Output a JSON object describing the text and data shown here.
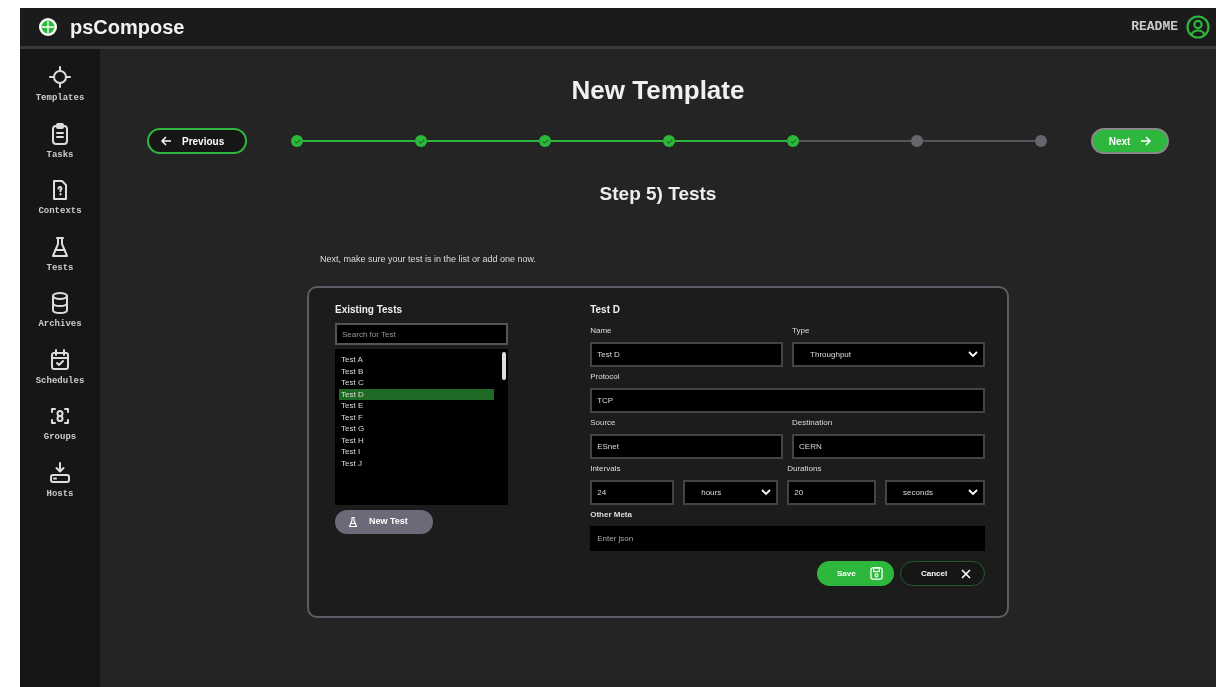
{
  "app": {
    "title": "psCompose",
    "readme": "README"
  },
  "sidebar": {
    "items": [
      {
        "label": "Templates",
        "selected": false
      },
      {
        "label": "Tasks",
        "selected": false
      },
      {
        "label": "Contexts",
        "selected": false
      },
      {
        "label": "Tests",
        "selected": false
      },
      {
        "label": "Archives",
        "selected": false
      },
      {
        "label": "Schedules",
        "selected": false
      },
      {
        "label": "Groups",
        "selected": false
      },
      {
        "label": "Hosts",
        "selected": false
      }
    ]
  },
  "page": {
    "title": "New Template",
    "previous": "Previous",
    "next": "Next",
    "step_title": "Step 5) Tests",
    "instruction": "Next, make sure your test is in the list or add one now."
  },
  "steps": [
    {
      "done": true
    },
    {
      "done": true
    },
    {
      "done": true
    },
    {
      "done": true
    },
    {
      "done": true
    },
    {
      "done": false
    },
    {
      "done": false
    }
  ],
  "tests": {
    "title": "Existing Tests",
    "search_placeholder": "Search for Test",
    "new_button": "New Test",
    "items": [
      {
        "label": "Test A",
        "selected": false
      },
      {
        "label": "Test B",
        "selected": false
      },
      {
        "label": "Test C",
        "selected": false
      },
      {
        "label": "Test D",
        "selected": true
      },
      {
        "label": "Test E",
        "selected": false
      },
      {
        "label": "Test F",
        "selected": false
      },
      {
        "label": "Test G",
        "selected": false
      },
      {
        "label": "Test H",
        "selected": false
      },
      {
        "label": "Test I",
        "selected": false
      },
      {
        "label": "Test J",
        "selected": false
      }
    ]
  },
  "form": {
    "title": "Test D",
    "rows": [
      [
        {
          "label": "Name",
          "controls": [
            {
              "kind": "text",
              "value": "Test D"
            }
          ]
        },
        {
          "label": "Type",
          "controls": [
            {
              "kind": "select",
              "value": "Throughput"
            }
          ]
        }
      ],
      [
        {
          "label": "Protocol",
          "controls": [
            {
              "kind": "text",
              "value": "TCP"
            }
          ]
        }
      ],
      [
        {
          "label": "Source",
          "controls": [
            {
              "kind": "text",
              "value": "ESnet"
            }
          ]
        },
        {
          "label": "Destination",
          "controls": [
            {
              "kind": "text",
              "value": "CERN"
            }
          ]
        }
      ],
      [
        {
          "label": "Intervals",
          "controls": [
            {
              "kind": "text",
              "value": "24"
            },
            {
              "kind": "select",
              "value": "hours"
            }
          ]
        },
        {
          "label": "Durations",
          "controls": [
            {
              "kind": "text",
              "value": "20"
            },
            {
              "kind": "select",
              "value": "seconds"
            }
          ]
        }
      ],
      [
        {
          "label": "Other Meta",
          "controls": [
            {
              "kind": "plain",
              "placeholder": "Enter json"
            }
          ]
        }
      ]
    ],
    "buttons": [
      {
        "kind": "save",
        "label": "Save"
      },
      {
        "kind": "cancel",
        "label": "Cancel"
      }
    ]
  }
}
